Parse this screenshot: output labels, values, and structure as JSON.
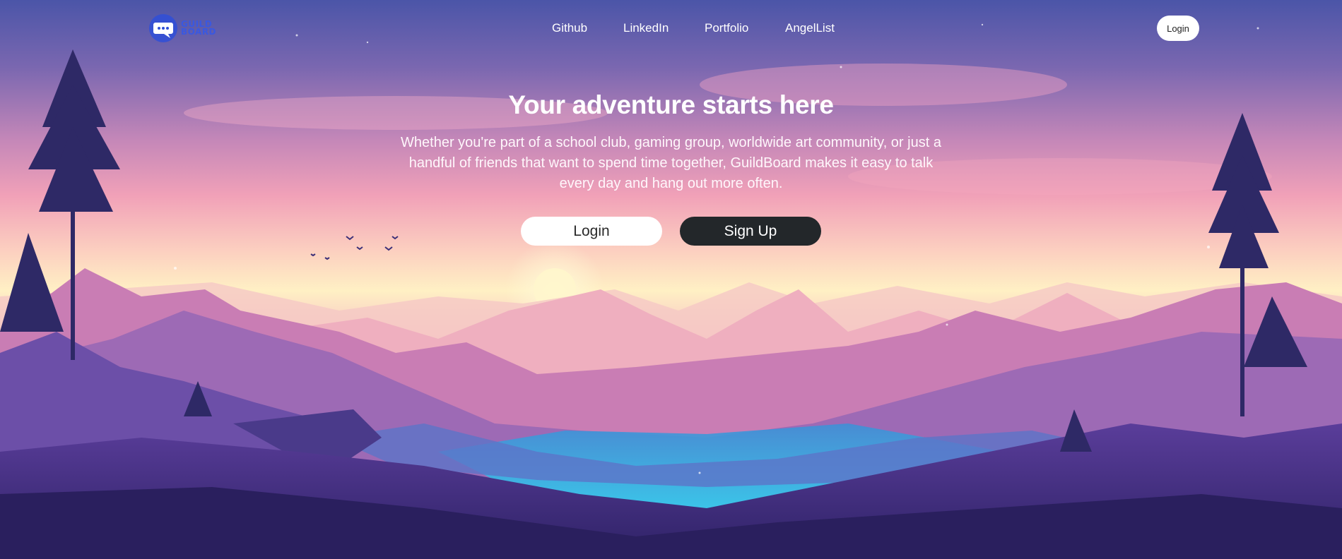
{
  "header": {
    "logo": {
      "text_line1": "GUILD",
      "text_line2": "BOARD",
      "icon": "chat-bubble-icon"
    },
    "nav": [
      {
        "label": "Github"
      },
      {
        "label": "LinkedIn"
      },
      {
        "label": "Portfolio"
      },
      {
        "label": "AngelList"
      }
    ],
    "login_label": "Login"
  },
  "hero": {
    "title": "Your adventure starts here",
    "description": "Whether you're part of a school club, gaming group, worldwide art community, or just a handful of friends that want to spend time together, GuildBoard makes it easy to talk every day and hang out more often.",
    "login_label": "Login",
    "signup_label": "Sign Up"
  },
  "colors": {
    "sky_top": "#4b55a8",
    "sky_pink": "#f1a1b8",
    "horizon": "#fff0c4",
    "mountain_far": "#f3bcc6",
    "mountain_mid": "#c97db4",
    "lake": "#2fb6e6",
    "foreground": "#3a2d78",
    "logo_blue": "#3a58e0",
    "signup_bg": "#23272a"
  }
}
